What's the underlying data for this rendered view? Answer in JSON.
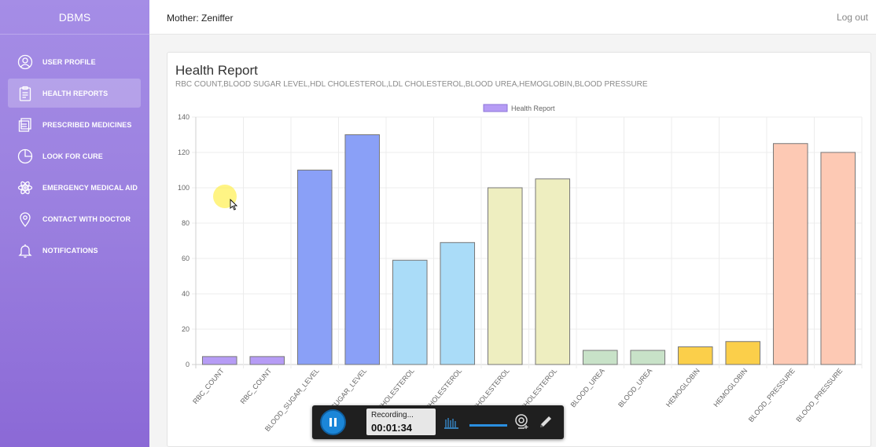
{
  "app": {
    "brand": "DBMS"
  },
  "sidebar": {
    "items": [
      {
        "label": "USER PROFILE",
        "icon": "user-icon",
        "active": false
      },
      {
        "label": "HEALTH REPORTS",
        "icon": "clipboard-icon",
        "active": true
      },
      {
        "label": "PRESCRIBED MEDICINES",
        "icon": "document-icon",
        "active": false
      },
      {
        "label": "LOOK FOR CURE",
        "icon": "pie-chart-icon",
        "active": false
      },
      {
        "label": "EMERGENCY MEDICAL AID",
        "icon": "atom-icon",
        "active": false
      },
      {
        "label": "CONTACT WITH DOCTOR",
        "icon": "location-pin-icon",
        "active": false
      },
      {
        "label": "NOTIFICATIONS",
        "icon": "bell-icon",
        "active": false
      }
    ]
  },
  "topbar": {
    "user": "Mother: Zeniffer",
    "logout": "Log out"
  },
  "report": {
    "title": "Health Report",
    "subtitle": "RBC COUNT,BLOOD SUGAR LEVEL,HDL CHOLESTEROL,LDL CHOLESTEROL,BLOOD UREA,HEMOGLOBIN,BLOOD PRESSURE"
  },
  "chart_data": {
    "type": "bar",
    "categories": [
      "RBC_COUNT",
      "RBC_COUNT",
      "BLOOD_SUGAR_LEVEL",
      "BLOOD_SUGAR_LEVEL",
      "HDL_CHOLESTEROL",
      "HDL_CHOLESTEROL",
      "LDL_CHOLESTEROL",
      "LDL_CHOLESTEROL",
      "BLOOD_UREA",
      "BLOOD_UREA",
      "HEMOGLOBIN",
      "HEMOGLOBIN",
      "BLOOD_PRESSURE",
      "BLOOD_PRESSURE"
    ],
    "series": [
      {
        "name": "Health Report",
        "values": [
          4.5,
          4.5,
          110,
          130,
          59,
          69,
          100,
          105,
          8,
          8,
          10,
          13,
          125,
          120
        ]
      }
    ],
    "colors": [
      "#b69cf5",
      "#b69cf5",
      "#8aa0f7",
      "#8aa0f7",
      "#aadcf8",
      "#aadcf8",
      "#eeeec0",
      "#eeeec0",
      "#c8e2c8",
      "#c8e2c8",
      "#fbcf4a",
      "#fbcf4a",
      "#fdc9b4",
      "#fdc9b4"
    ],
    "legend_color": "#b69cf5",
    "ylim": [
      0,
      140
    ],
    "yticks": [
      0,
      20,
      40,
      60,
      80,
      100,
      120,
      140
    ],
    "grid": true,
    "legend_position": "top-center"
  },
  "recorder": {
    "status": "Recording...",
    "time": "00:01:34"
  }
}
